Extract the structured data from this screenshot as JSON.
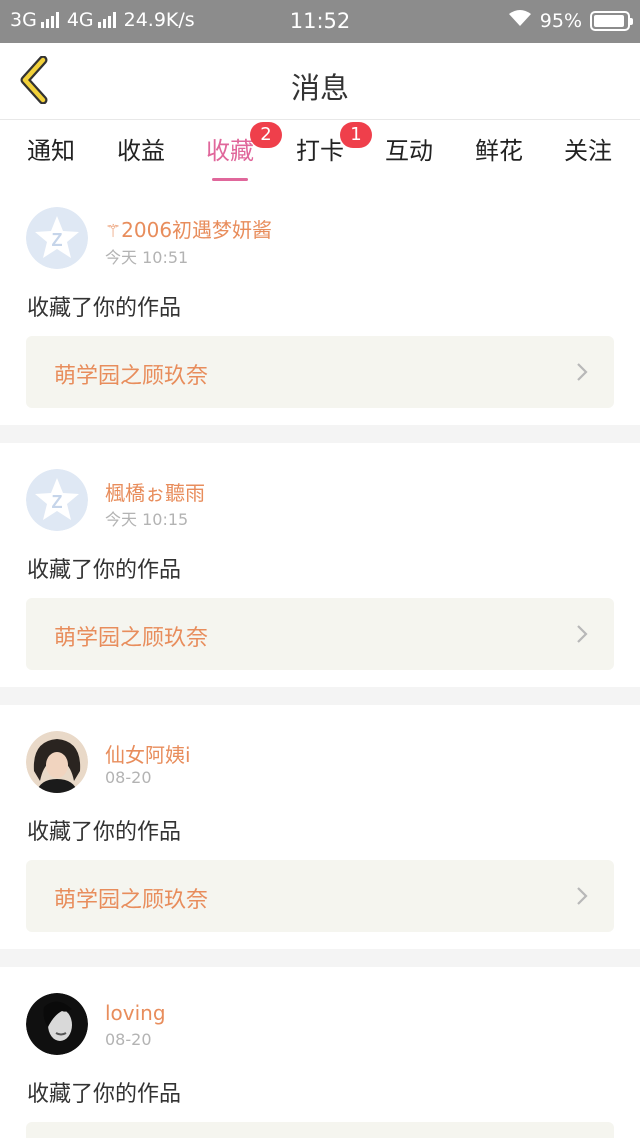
{
  "status": {
    "net1": "3G",
    "net2": "4G",
    "speed": "24.9K/s",
    "time": "11:52",
    "battery": "95%"
  },
  "header": {
    "title": "消息",
    "back_icon": "chevron-left-icon"
  },
  "tabs": [
    {
      "label": "通知"
    },
    {
      "label": "收益"
    },
    {
      "label": "收藏",
      "badge": "2",
      "active": true
    },
    {
      "label": "打卡",
      "badge": "1"
    },
    {
      "label": "互动"
    },
    {
      "label": "鲜花"
    },
    {
      "label": "关注"
    }
  ],
  "messages": [
    {
      "user": "2006初遇梦妍酱",
      "time": "今天 10:51",
      "text": "收藏了你的作品",
      "work": "萌学园之顾玖奈",
      "avatar": "star-avatar"
    },
    {
      "user": "楓橋ぉ聽雨",
      "time": "今天 10:15",
      "text": "收藏了你的作品",
      "work": "萌学园之顾玖奈",
      "avatar": "star-avatar"
    },
    {
      "user": "仙女阿姨i",
      "time": "08-20",
      "text": "收藏了你的作品",
      "work": "萌学园之顾玖奈",
      "avatar": "photo-avatar"
    },
    {
      "user": "loving",
      "time": "08-20",
      "text": "收藏了你的作品",
      "work": "",
      "avatar": "photo-avatar"
    }
  ],
  "colors": {
    "accent": "#e0679b",
    "username": "#e88d5c",
    "badge": "#ef3f4b",
    "card_bg": "#f5f5ef"
  }
}
